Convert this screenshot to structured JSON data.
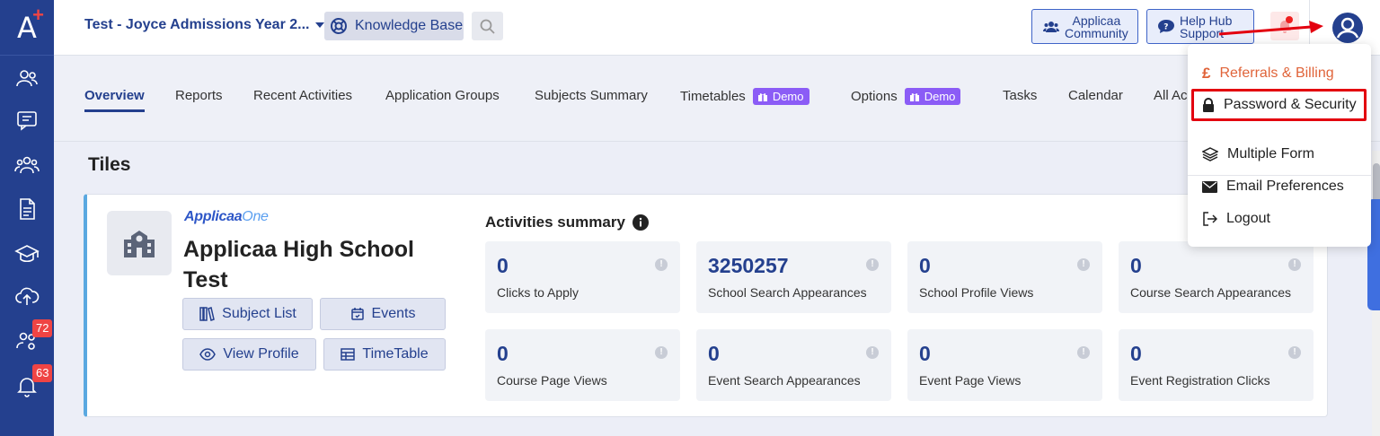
{
  "sidebar": {
    "logo": "A",
    "badges": {
      "groups": "72",
      "notifications": "63"
    }
  },
  "header": {
    "org_name": "Test - Joyce Admissions Year 2...",
    "knowledge_base": "Knowledge Base",
    "community_line1": "Applicaa",
    "community_line2": "Community",
    "help_line1": "Help Hub",
    "help_line2": "Support"
  },
  "tabs": [
    {
      "label": "Overview"
    },
    {
      "label": "Reports"
    },
    {
      "label": "Recent Activities"
    },
    {
      "label": "Application Groups"
    },
    {
      "label": "Subjects Summary"
    },
    {
      "label": "Timetables",
      "badge": "Demo"
    },
    {
      "label": "Options",
      "badge": "Demo"
    },
    {
      "label": "Tasks"
    },
    {
      "label": "Calendar"
    },
    {
      "label": "All Ac"
    }
  ],
  "tiles": {
    "title": "Tiles",
    "brand_main": "Applicaa",
    "brand_accent": "One",
    "school_name": "Applicaa High School Test",
    "buttons": {
      "subject_list": "Subject List",
      "events": "Events",
      "view_profile": "View Profile",
      "timetable": "TimeTable"
    },
    "activities_title": "Activities summary",
    "stats": [
      {
        "value": "0",
        "label": "Clicks to Apply"
      },
      {
        "value": "3250257",
        "label": "School Search Appearances"
      },
      {
        "value": "0",
        "label": "School Profile Views"
      },
      {
        "value": "0",
        "label": "Course Search Appearances"
      },
      {
        "value": "0",
        "label": "Course Page Views"
      },
      {
        "value": "0",
        "label": "Event Search Appearances"
      },
      {
        "value": "0",
        "label": "Event Page Views"
      },
      {
        "value": "0",
        "label": "Event Registration Clicks"
      }
    ]
  },
  "dropdown": {
    "referrals": "Referrals & Billing",
    "password": "Password & Security",
    "multiple_form": "Multiple Form",
    "email_prefs": "Email Preferences",
    "logout": "Logout"
  },
  "colors": {
    "sidebar": "#24408e",
    "accent": "#24408e",
    "demo_badge": "#8b5cf6",
    "highlight": "#e3000f",
    "referrals": "#e0643a"
  }
}
